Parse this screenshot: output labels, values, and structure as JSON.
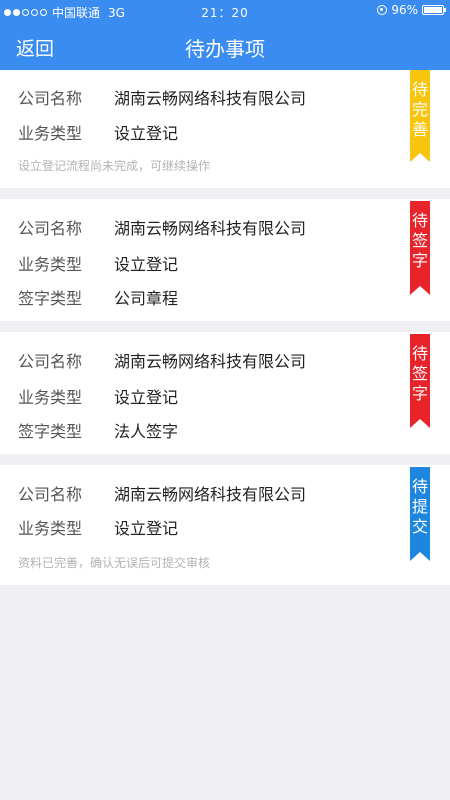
{
  "status_bar": {
    "carrier": "中国联通",
    "network": "3G",
    "time": "21：20",
    "battery": "96%"
  },
  "nav": {
    "back_label": "返回",
    "title": "待办事项"
  },
  "cards": [
    {
      "rows": [
        {
          "label": "公司名称",
          "value": "湖南云畅网络科技有限公司"
        },
        {
          "label": "业务类型",
          "value": "设立登记"
        }
      ],
      "note": "设立登记流程尚未完成，可继续操作",
      "badge": {
        "text": [
          "待",
          "完",
          "善"
        ],
        "color": "#f7c50d"
      }
    },
    {
      "rows": [
        {
          "label": "公司名称",
          "value": "湖南云畅网络科技有限公司"
        },
        {
          "label": "业务类型",
          "value": "设立登记"
        },
        {
          "label": "签字类型",
          "value": "公司章程"
        }
      ],
      "badge": {
        "text": [
          "待",
          "签",
          "字"
        ],
        "color": "#e8242a"
      }
    },
    {
      "rows": [
        {
          "label": "公司名称",
          "value": "湖南云畅网络科技有限公司"
        },
        {
          "label": "业务类型",
          "value": "设立登记"
        },
        {
          "label": "签字类型",
          "value": "法人签字"
        }
      ],
      "badge": {
        "text": [
          "待",
          "签",
          "字"
        ],
        "color": "#e8242a"
      }
    },
    {
      "rows": [
        {
          "label": "公司名称",
          "value": "湖南云畅网络科技有限公司"
        },
        {
          "label": "业务类型",
          "value": "设立登记"
        }
      ],
      "note": "资料已完善，确认无误后可提交审核",
      "badge": {
        "text": [
          "待",
          "提",
          "交"
        ],
        "color": "#1f86e0"
      }
    }
  ]
}
